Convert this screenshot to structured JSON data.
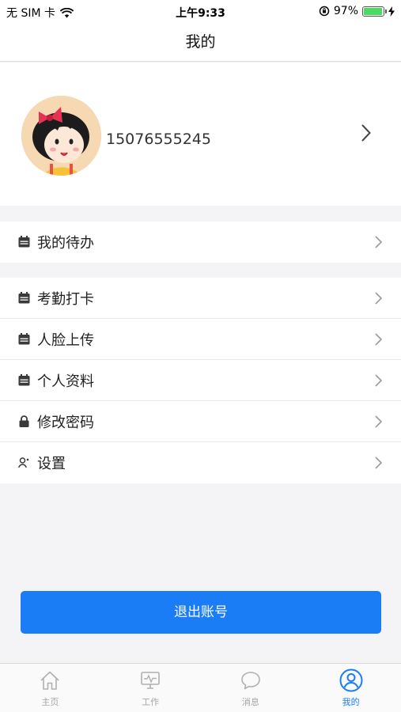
{
  "status_bar": {
    "carrier": "无 SIM 卡",
    "time": "上午9:33",
    "battery_percent": "97%",
    "battery_level": 0.97
  },
  "nav": {
    "title": "我的"
  },
  "profile": {
    "phone": "15076555245"
  },
  "menu_groups": [
    [
      {
        "label": "我的待办",
        "icon": "calendar-icon"
      }
    ],
    [
      {
        "label": "考勤打卡",
        "icon": "calendar-icon"
      },
      {
        "label": "人脸上传",
        "icon": "calendar-icon"
      },
      {
        "label": "个人资料",
        "icon": "calendar-icon"
      },
      {
        "label": "修改密码",
        "icon": "lock-icon"
      },
      {
        "label": "设置",
        "icon": "user-settings-icon"
      }
    ]
  ],
  "logout": {
    "label": "退出账号"
  },
  "tabs": [
    {
      "label": "主页",
      "icon": "home-icon",
      "active": false
    },
    {
      "label": "工作",
      "icon": "monitor-icon",
      "active": false
    },
    {
      "label": "消息",
      "icon": "chat-icon",
      "active": false
    },
    {
      "label": "我的",
      "icon": "user-icon",
      "active": true
    }
  ],
  "colors": {
    "accent": "#1a7df5",
    "background": "#f4f4f6",
    "battery": "#4cd964"
  }
}
